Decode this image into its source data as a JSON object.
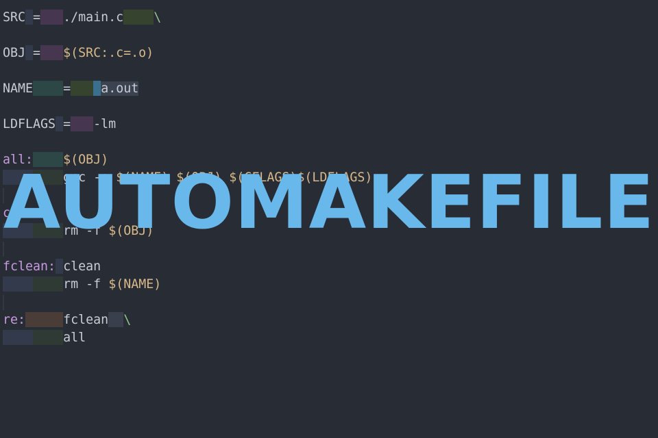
{
  "overlay": {
    "title": "AUTOMAKEFILE"
  },
  "colors": {
    "background": "#282c34",
    "title": "#69b8ec",
    "string": "#d9b98a",
    "target": "#c89be0",
    "continuation": "#93c58a",
    "text": "#c8ccd4"
  },
  "editor": {
    "lines": [
      {
        "tokens": [
          {
            "t": "SRC",
            "c": "var"
          },
          {
            "w": 1,
            "bg": "blue"
          },
          {
            "t": "=",
            "c": "punc"
          },
          {
            "w": 3,
            "bg": "purple"
          },
          {
            "t": "./main.c",
            "c": "var"
          },
          {
            "w": 4,
            "bg": "green"
          },
          {
            "t": "\\",
            "c": "cont"
          }
        ]
      },
      {
        "blank": true
      },
      {
        "tokens": [
          {
            "t": "OBJ",
            "c": "var"
          },
          {
            "w": 1,
            "bg": "blue"
          },
          {
            "t": "=",
            "c": "punc"
          },
          {
            "w": 3,
            "bg": "purple"
          },
          {
            "t": "$(SRC:.c=.o)",
            "c": "str"
          }
        ]
      },
      {
        "blank": true
      },
      {
        "tokens": [
          {
            "t": "NAME",
            "c": "var"
          },
          {
            "w": 4,
            "bg": "teal"
          },
          {
            "t": "=",
            "c": "punc"
          },
          {
            "w": 3,
            "bg": "green"
          },
          {
            "w": 1,
            "bg": "cyan"
          },
          {
            "t": "a.out",
            "c": "var",
            "sel": true
          }
        ]
      },
      {
        "blank": true
      },
      {
        "tokens": [
          {
            "t": "LDFLAGS",
            "c": "var"
          },
          {
            "w": 1,
            "bg": "blue"
          },
          {
            "t": "=",
            "c": "punc"
          },
          {
            "w": 3,
            "bg": "purple"
          },
          {
            "t": "-lm",
            "c": "var"
          }
        ]
      },
      {
        "blank": true
      },
      {
        "tokens": [
          {
            "t": "all:",
            "c": "tgt"
          },
          {
            "w": 4,
            "bg": "teal"
          },
          {
            "t": "$(OBJ)",
            "c": "str"
          }
        ]
      },
      {
        "tokens": [
          {
            "w": 4,
            "bg": "blue"
          },
          {
            "w": 4,
            "bg": "dkgreen"
          },
          {
            "t": "gcc -o ",
            "c": "cmd"
          },
          {
            "t": "$(NAME) $(OBJ) $(CFLAGS)$(LDFLAGS)",
            "c": "str"
          }
        ]
      },
      {
        "blank": true,
        "bar": true
      },
      {
        "tokens": [
          {
            "t": "clean:",
            "c": "tgt"
          }
        ]
      },
      {
        "tokens": [
          {
            "w": 4,
            "bg": "blue"
          },
          {
            "w": 4,
            "bg": "dkgreen"
          },
          {
            "t": "rm -f ",
            "c": "cmd"
          },
          {
            "t": "$(OBJ)",
            "c": "str"
          }
        ]
      },
      {
        "blank": true,
        "bar": true
      },
      {
        "tokens": [
          {
            "t": "fclean:",
            "c": "tgt"
          },
          {
            "w": 1,
            "bg": "blue"
          },
          {
            "t": "clean",
            "c": "cmd"
          }
        ]
      },
      {
        "tokens": [
          {
            "w": 4,
            "bg": "blue"
          },
          {
            "w": 4,
            "bg": "dkgreen"
          },
          {
            "t": "rm -f ",
            "c": "cmd"
          },
          {
            "t": "$(NAME)",
            "c": "str"
          }
        ]
      },
      {
        "blank": true,
        "bar": true
      },
      {
        "tokens": [
          {
            "t": "re:",
            "c": "tgt"
          },
          {
            "w": 5,
            "bg": "brown"
          },
          {
            "t": "fclean",
            "c": "cmd"
          },
          {
            "w": 2,
            "bg": "slate"
          },
          {
            "t": "\\",
            "c": "cont"
          }
        ]
      },
      {
        "tokens": [
          {
            "w": 4,
            "bg": "blue"
          },
          {
            "w": 4,
            "bg": "dkgreen"
          },
          {
            "t": "all",
            "c": "cmd"
          }
        ]
      }
    ]
  }
}
